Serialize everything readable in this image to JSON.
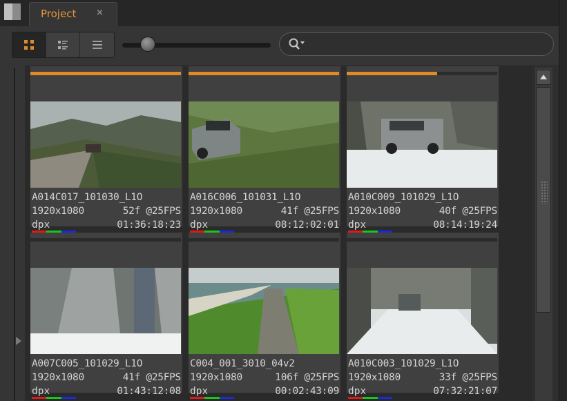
{
  "tab": {
    "label": "Project",
    "close": "×"
  },
  "toolbar": {
    "view_modes": [
      "grid-view",
      "detail-view",
      "list-view"
    ],
    "active_view": "grid-view",
    "zoom_level": 0.13,
    "search": {
      "value": "",
      "placeholder": ""
    }
  },
  "colors": {
    "accent": "#e08a2a",
    "red": "#e01818",
    "green": "#18c818",
    "blue": "#1a2ad8"
  },
  "clips": [
    {
      "name": "A014C017_101030_L1O",
      "resolution": "1920x1080",
      "frames": " 52f @25FPS",
      "format": "dpx",
      "timecode": "01:36:18:23",
      "progress": 1.0,
      "scene": "mountain-road"
    },
    {
      "name": "A016C006_101031_L1O",
      "resolution": "1920x1080",
      "frames": " 41f @25FPS",
      "format": "dpx",
      "timecode": "08:12:02:01",
      "progress": 1.0,
      "scene": "grass-car"
    },
    {
      "name": "A010C009_101029_L1O",
      "resolution": "1920x1080",
      "frames": " 40f @25FPS",
      "format": "dpx",
      "timecode": "08:14:19:24",
      "progress": 0.6,
      "scene": "snow-car"
    },
    {
      "name": "A007C005_101029_L1O",
      "resolution": "1920x1080",
      "frames": " 41f @25FPS",
      "format": "dpx",
      "timecode": "01:43:12:08",
      "progress": 0,
      "scene": "snow-forest"
    },
    {
      "name": "C004_001_3010_04v2",
      "resolution": "1920x1080",
      "frames": "106f @25FPS",
      "format": "dpx",
      "timecode": "00:02:43:09",
      "progress": 0,
      "scene": "coast-road"
    },
    {
      "name": "A010C003_101029_L1O",
      "resolution": "1920x1080",
      "frames": " 33f @25FPS",
      "format": "dpx",
      "timecode": "07:32:21:07",
      "progress": 0,
      "scene": "snow-road"
    }
  ]
}
